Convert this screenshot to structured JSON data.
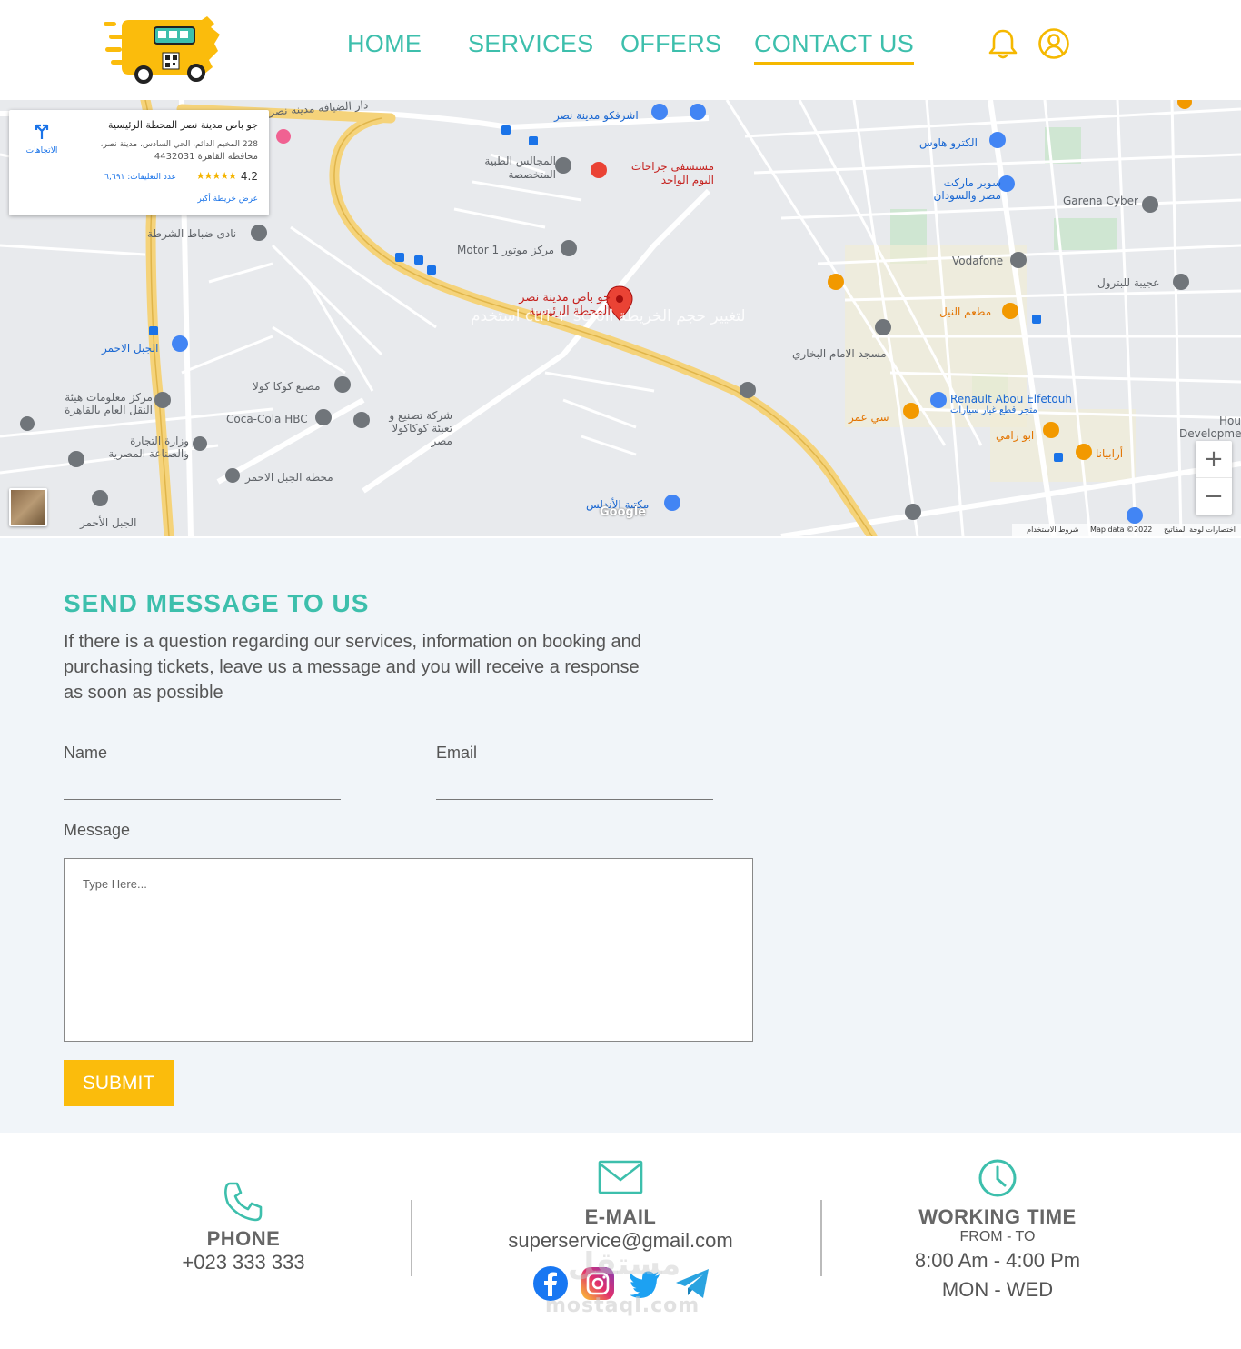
{
  "nav": {
    "items": [
      {
        "label": "HOME"
      },
      {
        "label": "SERVICES"
      },
      {
        "label": "OFFERS"
      },
      {
        "label": "CONTACT US"
      }
    ]
  },
  "map": {
    "card": {
      "title": "جو باص مدينة نصر المحطة الرئيسية",
      "address_line1": "228 المخيم الدائم، الحي السادس، مدينة نصر،",
      "address_line2": "محافظة القاهرة 4432031",
      "rating": "4.2",
      "stars": "★★★★★",
      "reviews": "عدد التعليقات: ٦,٦٩١",
      "bigger_map": "عرض خريطة أكبر",
      "directions": "الاتجاهات"
    },
    "hint": "استخدم ctrl + scroll لتغيير حجم الخريطة",
    "zoom_in": "+",
    "zoom_out": "−",
    "footer": {
      "shortcuts": "اختصارات لوحة المفاتيح",
      "data": "Map data ©2022",
      "terms": "شروط الاستخدام"
    },
    "google": "Google",
    "labels": {
      "pin": "جو باص مدينة نصر المحطة الرئيسية",
      "motor": "Motor 1 مركز موتور",
      "hospital": "مستشفى جراحات اليوم الواحد",
      "majalis": "المجالس الطبية المتخصصة",
      "sharafco": "اشرفكو مدينة نصر",
      "electro": "الكترو هاوس",
      "super": "سوبر ماركت مصر والسودان",
      "garena": "Garena Cyber",
      "vodafone": "Vodafone",
      "ajiba": "عجيبة للبترول",
      "nile": "مطعم النيل",
      "bukhari": "مسجد الامام البخاري",
      "renault": "Renault Abou Elfetouh",
      "renault_sub": "متجر قطع غيار سيارات",
      "sioumar": "سي عمر",
      "aburami": "ابو رامي",
      "arabiana": "أرابيانا",
      "nadi": "نادى ضباط الشرطة",
      "jabal": "الجبل الاحمر",
      "coca_fac": "مصنع كوكا كولا",
      "coca_hbc": "Coca-Cola HBC",
      "coca_bottle": "شركة تصنيع و تعبئة كوكاكولا مصر",
      "hayna": "مركز معلومات هيئة النقل العام بالقاهرة",
      "wizara": "وزارة التجارة والصناعة المصرية",
      "mahatta": "محطه الجبل الاحمر",
      "jabal2": "الجبل الأحمر",
      "library": "مكتبة الأندلس",
      "dar": "دار الضيافه مدينه نصر",
      "hou": "Hou",
      "develop": "Developme"
    }
  },
  "contact": {
    "title": "SEND MESSAGE TO US",
    "description": "If there is a question regarding our services, information on booking and purchasing tickets, leave us a message and you will receive a response as soon as possible",
    "name_label": "Name",
    "email_label": "Email",
    "message_label": "Message",
    "message_placeholder": "Type Here...",
    "submit": "SUBMIT"
  },
  "info": {
    "phone_title": "PHONE",
    "phone_value": "+023 333 333",
    "email_title": "E-MAIL",
    "email_value": "superservice@gmail.com",
    "time_title": "WORKING TIME",
    "time_from_to": "FROM - TO",
    "time_hours": "8:00 Am - 4:00 Pm",
    "time_days": "MON - WED"
  },
  "watermark": {
    "ar": "مستقل",
    "en": "mostaql.com"
  },
  "colors": {
    "accent": "#3dbfac",
    "button": "#fbbc0c",
    "nav_underline": "#f5b800",
    "section_bg": "#f1f5f9"
  }
}
